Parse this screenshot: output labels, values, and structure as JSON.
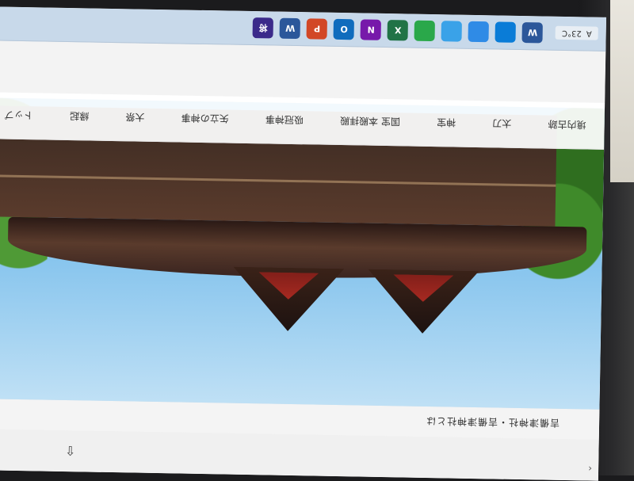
{
  "taskbar": {
    "temperature": "23°C",
    "tray_text": "A",
    "apps": [
      {
        "name": "word",
        "label": "W",
        "color": "#2b579a"
      },
      {
        "name": "edge",
        "label": "",
        "color": "#0a7cd7"
      },
      {
        "name": "explorer",
        "label": "",
        "color": "#2f8be6"
      },
      {
        "name": "edge2",
        "label": "",
        "color": "#3aa2e8"
      },
      {
        "name": "chrome",
        "label": "",
        "color": "#2aa84a"
      },
      {
        "name": "excel",
        "label": "X",
        "color": "#217346"
      },
      {
        "name": "onenote",
        "label": "N",
        "color": "#7719aa"
      },
      {
        "name": "outlook",
        "label": "O",
        "color": "#0f6cbd"
      },
      {
        "name": "powerpoint",
        "label": "P",
        "color": "#d24726"
      },
      {
        "name": "word2",
        "label": "W",
        "color": "#2b579a"
      },
      {
        "name": "shogi",
        "label": "将",
        "color": "#3b2a8a"
      }
    ]
  },
  "site": {
    "title": "吉備津神社・吉備津神社とは"
  },
  "nav": {
    "items": [
      "境内古跡",
      "太刀",
      "神宝",
      "国宝 本殿拝殿",
      "吸冠神事",
      "矢立の神事",
      "大祭",
      "縁起",
      "トップ"
    ]
  },
  "browser": {
    "collapse_arrow": "‹",
    "right_arrow": "‹"
  }
}
